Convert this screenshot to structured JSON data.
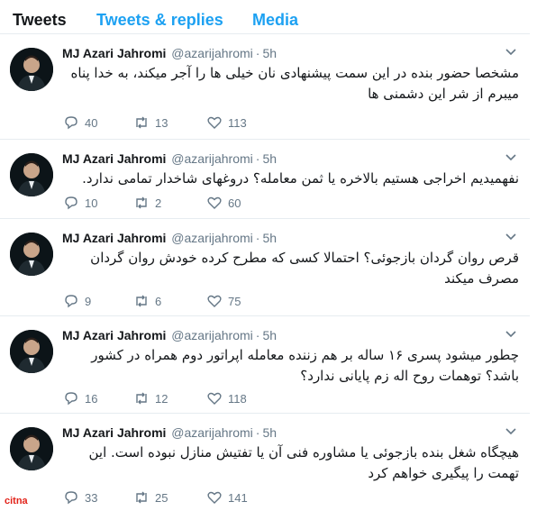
{
  "tabs": [
    {
      "label": "Tweets",
      "active": true
    },
    {
      "label": "Tweets & replies",
      "active": false
    },
    {
      "label": "Media",
      "active": false
    }
  ],
  "colors": {
    "accent": "#1da1f2",
    "muted": "#657786",
    "text": "#14171a",
    "logo": "#e2231a"
  },
  "icons": {
    "reply": "reply-icon",
    "retweet": "retweet-icon",
    "like": "heart-icon",
    "menu": "chevron-down-icon"
  },
  "watermark": "citna",
  "tweets": [
    {
      "name": "MJ Azari Jahromi",
      "handle": "@azarijahromi",
      "time": "5h",
      "text": "مشخصا حضور بنده در این سمت پیشنهادی نان خیلی ها را آجر میکند، به خدا پناه میبرم از شر این دشمنی ها",
      "replies": "40",
      "retweets": "13",
      "likes": "113"
    },
    {
      "name": "MJ Azari Jahromi",
      "handle": "@azarijahromi",
      "time": "5h",
      "text": "نفهمیدیم اخراجی هستیم بالاخره یا ثمن معامله؟ دروغهای شاخدار تمامی ندارد.",
      "replies": "10",
      "retweets": "2",
      "likes": "60"
    },
    {
      "name": "MJ Azari Jahromi",
      "handle": "@azarijahromi",
      "time": "5h",
      "text": "قرص روان گردان بازجوئی؟ احتمالا کسی که مطرح کرده خودش روان گردان مصرف میکند",
      "replies": "9",
      "retweets": "6",
      "likes": "75"
    },
    {
      "name": "MJ Azari Jahromi",
      "handle": "@azarijahromi",
      "time": "5h",
      "text": "چطور میشود پسری ۱۶ ساله بر هم زننده معامله اپراتور دوم همراه در کشور باشد؟ توهمات روح اله زم پایانی ندارد؟",
      "replies": "16",
      "retweets": "12",
      "likes": "118"
    },
    {
      "name": "MJ Azari Jahromi",
      "handle": "@azarijahromi",
      "time": "5h",
      "text": "هیچگاه شغل بنده بازجوئی یا مشاوره فنی آن یا تفتیش منازل نبوده است. این تهمت را پیگیری خواهم کرد",
      "replies": "33",
      "retweets": "25",
      "likes": "141"
    }
  ]
}
